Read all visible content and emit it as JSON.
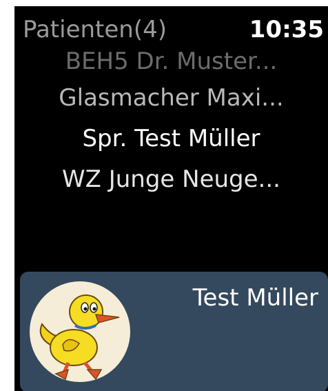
{
  "status_bar": {
    "title": "Patienten(4)",
    "time": "10:35"
  },
  "patient_list": {
    "items": [
      {
        "label": "BEH5 Dr. Muster..."
      },
      {
        "label": "Glasmacher Maxi..."
      },
      {
        "label": "Spr. Test Müller"
      },
      {
        "label": "WZ Junge Neuge..."
      }
    ]
  },
  "notification": {
    "name": "Test Müller",
    "avatar_icon": "duck-avatar-icon"
  }
}
